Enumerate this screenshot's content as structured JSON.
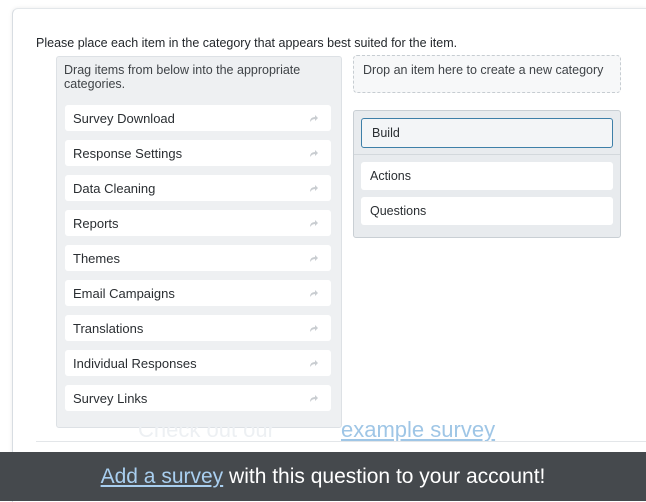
{
  "question": {
    "text": "Please place each item in the category that appears best suited for the item."
  },
  "source_list": {
    "header": "Drag items from below into the appropriate categories.",
    "items": [
      {
        "label": "Survey Download"
      },
      {
        "label": "Response Settings"
      },
      {
        "label": "Data Cleaning"
      },
      {
        "label": "Reports"
      },
      {
        "label": "Themes"
      },
      {
        "label": "Email Campaigns"
      },
      {
        "label": "Translations"
      },
      {
        "label": "Individual Responses"
      },
      {
        "label": "Survey Links"
      }
    ],
    "item_icon": "move-arrow-icon"
  },
  "new_category": {
    "placeholder": "Drop an item here to create a new category"
  },
  "category": {
    "title": "Build",
    "items": [
      {
        "label": "Actions"
      },
      {
        "label": "Questions"
      }
    ]
  },
  "footer": {
    "ghost_text": "Check out our",
    "example_link": "example survey",
    "banner_link": "Add a survey",
    "banner_text": " with this question to your account!"
  },
  "colors": {
    "banner_bg": "#45494d",
    "link": "#a9cff0",
    "category_focus_border": "#3d7fa8"
  }
}
